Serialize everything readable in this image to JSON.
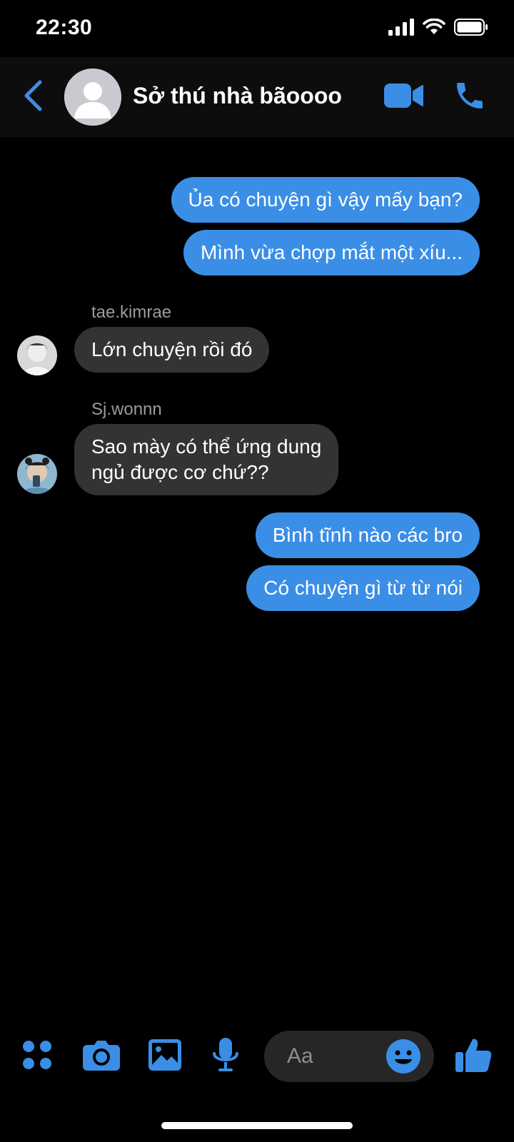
{
  "status_bar": {
    "time": "22:30",
    "icons": [
      "cellular-signal-icon",
      "wifi-icon",
      "battery-icon"
    ]
  },
  "header": {
    "title": "Sở thú nhà bãoooo",
    "icons": [
      "back-chevron-icon",
      "group-avatar-placeholder",
      "video-camera-icon",
      "phone-icon"
    ]
  },
  "messages": [
    {
      "direction": "outgoing",
      "text": "Ủa có chuyện gì vậy mấy bạn?"
    },
    {
      "direction": "outgoing",
      "text": "Mình vừa chợp mắt một xíu..."
    },
    {
      "direction": "incoming",
      "sender": "tae.kimrae",
      "text": "Lớn chuyện rồi đó"
    },
    {
      "direction": "incoming",
      "sender": "Sj.wonnn",
      "lines": [
        "Sao mày có thể ứng dung",
        "ngủ được cơ chứ??"
      ]
    },
    {
      "direction": "outgoing",
      "text": "Bình tĩnh nào các bro"
    },
    {
      "direction": "outgoing",
      "text": "Có chuyện gì từ từ nói"
    }
  ],
  "composer": {
    "placeholder": "Aa",
    "icons": [
      "apps-grid-icon",
      "camera-icon",
      "gallery-icon",
      "microphone-icon",
      "emoji-icon",
      "thumbs-up-icon"
    ]
  },
  "colors": {
    "accent": "#3a8ee6",
    "incoming_bubble": "#333333",
    "background": "#000000"
  }
}
